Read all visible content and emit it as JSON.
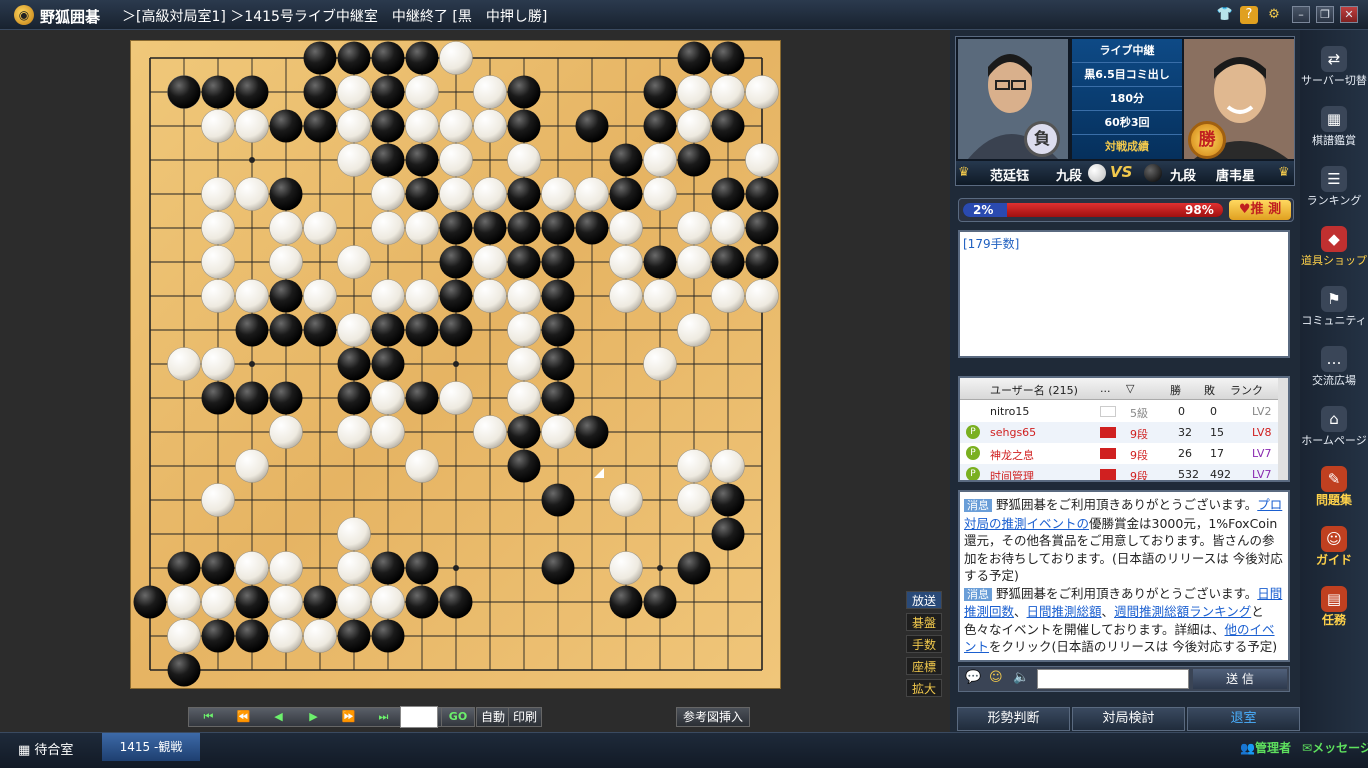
{
  "titlebar": {
    "app_name": "野狐囲碁",
    "room_title": "＞[高級対局室1] ＞1415号ライブ中継室　中継終了 [黒　中押し勝]"
  },
  "board": {
    "size": 19,
    "star_points": [
      [
        3,
        3
      ],
      [
        3,
        9
      ],
      [
        3,
        15
      ],
      [
        9,
        3
      ],
      [
        9,
        9
      ],
      [
        9,
        15
      ],
      [
        15,
        3
      ],
      [
        15,
        9
      ],
      [
        15,
        15
      ]
    ],
    "last_move": [
      13,
      12
    ],
    "black": [
      [
        5,
        0
      ],
      [
        6,
        0
      ],
      [
        7,
        0
      ],
      [
        8,
        0
      ],
      [
        16,
        0
      ],
      [
        17,
        0
      ],
      [
        1,
        1
      ],
      [
        2,
        1
      ],
      [
        3,
        1
      ],
      [
        5,
        1
      ],
      [
        7,
        1
      ],
      [
        11,
        1
      ],
      [
        15,
        1
      ],
      [
        4,
        2
      ],
      [
        5,
        2
      ],
      [
        7,
        2
      ],
      [
        11,
        2
      ],
      [
        13,
        2
      ],
      [
        15,
        2
      ],
      [
        17,
        2
      ],
      [
        7,
        3
      ],
      [
        8,
        3
      ],
      [
        14,
        3
      ],
      [
        16,
        3
      ],
      [
        4,
        4
      ],
      [
        8,
        4
      ],
      [
        11,
        4
      ],
      [
        14,
        4
      ],
      [
        17,
        4
      ],
      [
        18,
        4
      ],
      [
        9,
        5
      ],
      [
        10,
        5
      ],
      [
        11,
        5
      ],
      [
        12,
        5
      ],
      [
        13,
        5
      ],
      [
        18,
        5
      ],
      [
        9,
        6
      ],
      [
        11,
        6
      ],
      [
        12,
        6
      ],
      [
        15,
        6
      ],
      [
        17,
        6
      ],
      [
        18,
        6
      ],
      [
        4,
        7
      ],
      [
        9,
        7
      ],
      [
        12,
        7
      ],
      [
        3,
        8
      ],
      [
        4,
        8
      ],
      [
        5,
        8
      ],
      [
        7,
        8
      ],
      [
        8,
        8
      ],
      [
        9,
        8
      ],
      [
        12,
        8
      ],
      [
        6,
        9
      ],
      [
        7,
        9
      ],
      [
        12,
        9
      ],
      [
        2,
        10
      ],
      [
        3,
        10
      ],
      [
        4,
        10
      ],
      [
        6,
        10
      ],
      [
        8,
        10
      ],
      [
        12,
        10
      ],
      [
        11,
        11
      ],
      [
        13,
        11
      ],
      [
        11,
        12
      ],
      [
        12,
        13
      ],
      [
        17,
        13
      ],
      [
        17,
        14
      ],
      [
        1,
        15
      ],
      [
        2,
        15
      ],
      [
        7,
        15
      ],
      [
        8,
        15
      ],
      [
        12,
        15
      ],
      [
        16,
        15
      ],
      [
        0,
        16
      ],
      [
        3,
        16
      ],
      [
        5,
        16
      ],
      [
        8,
        16
      ],
      [
        9,
        16
      ],
      [
        14,
        16
      ],
      [
        15,
        16
      ],
      [
        2,
        17
      ],
      [
        3,
        17
      ],
      [
        6,
        17
      ],
      [
        7,
        17
      ],
      [
        1,
        18
      ]
    ],
    "white": [
      [
        9,
        0
      ],
      [
        1,
        1
      ],
      [
        16,
        1
      ],
      [
        17,
        1
      ],
      [
        18,
        1
      ],
      [
        6,
        1
      ],
      [
        8,
        1
      ],
      [
        10,
        1
      ],
      [
        2,
        2
      ],
      [
        3,
        2
      ],
      [
        6,
        2
      ],
      [
        8,
        2
      ],
      [
        9,
        2
      ],
      [
        10,
        2
      ],
      [
        16,
        2
      ],
      [
        6,
        3
      ],
      [
        9,
        3
      ],
      [
        11,
        3
      ],
      [
        15,
        3
      ],
      [
        18,
        3
      ],
      [
        2,
        4
      ],
      [
        3,
        4
      ],
      [
        7,
        4
      ],
      [
        9,
        4
      ],
      [
        10,
        4
      ],
      [
        12,
        4
      ],
      [
        13,
        4
      ],
      [
        15,
        4
      ],
      [
        2,
        5
      ],
      [
        4,
        5
      ],
      [
        5,
        5
      ],
      [
        7,
        5
      ],
      [
        8,
        5
      ],
      [
        14,
        5
      ],
      [
        16,
        5
      ],
      [
        17,
        5
      ],
      [
        2,
        6
      ],
      [
        4,
        6
      ],
      [
        6,
        6
      ],
      [
        10,
        6
      ],
      [
        14,
        6
      ],
      [
        16,
        6
      ],
      [
        2,
        7
      ],
      [
        3,
        7
      ],
      [
        5,
        7
      ],
      [
        7,
        7
      ],
      [
        8,
        7
      ],
      [
        10,
        7
      ],
      [
        11,
        7
      ],
      [
        14,
        7
      ],
      [
        15,
        7
      ],
      [
        17,
        7
      ],
      [
        18,
        7
      ],
      [
        6,
        8
      ],
      [
        11,
        8
      ],
      [
        16,
        8
      ],
      [
        1,
        9
      ],
      [
        2,
        9
      ],
      [
        11,
        9
      ],
      [
        15,
        9
      ],
      [
        7,
        10
      ],
      [
        9,
        10
      ],
      [
        11,
        10
      ],
      [
        4,
        11
      ],
      [
        6,
        11
      ],
      [
        7,
        11
      ],
      [
        10,
        11
      ],
      [
        12,
        11
      ],
      [
        3,
        12
      ],
      [
        8,
        12
      ],
      [
        16,
        12
      ],
      [
        17,
        12
      ],
      [
        2,
        13
      ],
      [
        14,
        13
      ],
      [
        16,
        13
      ],
      [
        6,
        14
      ],
      [
        3,
        15
      ],
      [
        4,
        15
      ],
      [
        6,
        15
      ],
      [
        14,
        15
      ],
      [
        1,
        16
      ],
      [
        2,
        16
      ],
      [
        4,
        16
      ],
      [
        6,
        16
      ],
      [
        7,
        16
      ],
      [
        1,
        17
      ],
      [
        4,
        17
      ],
      [
        5,
        17
      ]
    ]
  },
  "board_side_buttons": [
    "放送",
    "碁盤",
    "手数",
    "座標",
    "拡大"
  ],
  "nav": {
    "buttons": [
      "⏮",
      "⏪",
      "◀",
      "▶",
      "⏩",
      "⏭"
    ],
    "go": "GO",
    "auto": "自動",
    "print": "印刷",
    "insert": "参考図挿入"
  },
  "players": {
    "info": [
      "ライブ中継",
      "黒6.5目コミ出し",
      "180分",
      "60秒3回",
      "対戦成績"
    ],
    "left_badge": "負",
    "right_badge": "勝",
    "left_name": "范廷钰",
    "left_rank": "九段",
    "right_rank": "九段",
    "right_name": "唐韦星",
    "vs": "VS"
  },
  "predict": {
    "left_pct": "2%",
    "right_pct": "98%",
    "left_frac": 0.02,
    "button": "♥推 測"
  },
  "move_count": "[179手数]",
  "users": {
    "headers": [
      "ユーザー名 (215)",
      "...",
      "勝",
      "敗",
      "ランク"
    ],
    "rows": [
      {
        "name": "nitro15",
        "rank": "5級",
        "w": "0",
        "l": "0",
        "lv": "LV2",
        "red": false
      },
      {
        "name": "sehgs65",
        "rank": "9段",
        "w": "32",
        "l": "15",
        "lv": "LV8",
        "red": true
      },
      {
        "name": "神龙之息",
        "rank": "9段",
        "w": "26",
        "l": "17",
        "lv": "LV7",
        "red": true
      },
      {
        "name": "时间管理",
        "rank": "9段",
        "w": "532",
        "l": "492",
        "lv": "LV7",
        "red": true
      }
    ]
  },
  "chat": {
    "tag": "消息",
    "m1_a": "野狐囲碁をご利用頂きありがとうございます。",
    "m1_link": "プロ対局の推測イベントの",
    "m1_b": "優勝賞金は3000元，1%FoxCoin還元，その他各賞品をご用意しております。皆さんの参加をお待ちしております。(日本語のリリースは 今後対応する予定)",
    "m2_a": "野狐囲碁をご利用頂きありがとうございます。",
    "m2_l1": "日間推測回数",
    "m2_sep1": "、",
    "m2_l2": "日間推測総額",
    "m2_sep2": "、",
    "m2_l3": "週間推測総額ランキング",
    "m2_b": "と色々なイベントを開催しております。詳細は、",
    "m2_l4": "他のイベント",
    "m2_c": "をクリック(日本語のリリースは 今後対応する予定)",
    "send": "送 信"
  },
  "bottom_buttons": [
    "形勢判断",
    "対局検討",
    "退室"
  ],
  "sidebar": [
    {
      "label": "サーバー切替",
      "icon": "server-icon",
      "glyph": "⇄"
    },
    {
      "label": "棋譜鑑賞",
      "icon": "kifu-icon",
      "glyph": "▦"
    },
    {
      "label": "ランキング",
      "icon": "ranking-icon",
      "glyph": "☰"
    },
    {
      "label": "道具ショップ",
      "icon": "shop-icon",
      "glyph": "◆"
    },
    {
      "label": "コミュニティ",
      "icon": "community-icon",
      "glyph": "⚑"
    },
    {
      "label": "交流広場",
      "icon": "chat-icon",
      "glyph": "…"
    },
    {
      "label": "ホームページ",
      "icon": "home-icon",
      "glyph": "⌂"
    },
    {
      "label": "問題集",
      "icon": "problem-icon",
      "glyph": "✎"
    },
    {
      "label": "ガイド",
      "icon": "guide-icon",
      "glyph": "☺"
    },
    {
      "label": "任務",
      "icon": "task-icon",
      "glyph": "▤"
    }
  ],
  "statusbar": {
    "wait": "待合室",
    "watch": "1415 -観戦",
    "admin": "管理者",
    "msg": "メッセージ"
  }
}
